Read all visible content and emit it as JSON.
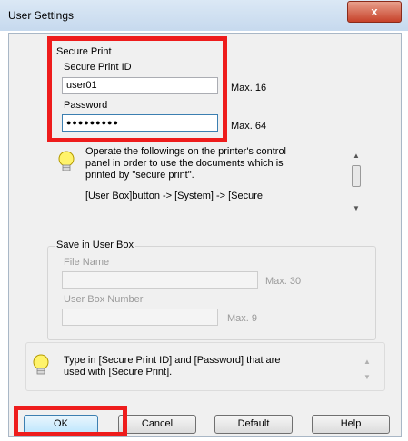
{
  "window": {
    "title": "User Settings",
    "close_glyph": "x"
  },
  "secure_print": {
    "group_label": "Secure Print",
    "id_label": "Secure Print ID",
    "id_value": "user01",
    "id_max": "Max. 16",
    "password_label": "Password",
    "password_value": "●●●●●●●●●",
    "password_max": "Max. 64",
    "info_lines": [
      "Operate the followings on the printer's control",
      "panel in order to use the documents which is",
      "printed by \"secure print\".",
      "[User Box]button -> [System] -> [Secure"
    ]
  },
  "save_in_user_box": {
    "group_label": "Save in User Box",
    "file_name_label": "File Name",
    "file_name_value": "",
    "file_name_max": "Max. 30",
    "box_number_label": "User Box Number",
    "box_number_value": "",
    "box_number_max": "Max. 9"
  },
  "hint": {
    "lines": [
      "Type in [Secure Print ID] and [Password] that are",
      "used with [Secure Print]."
    ]
  },
  "buttons": {
    "ok": "OK",
    "cancel": "Cancel",
    "default": "Default",
    "help": "Help"
  },
  "icons": {
    "bulb": "lightbulb-icon",
    "close": "close-icon"
  },
  "colors": {
    "highlight": "#ee1c1c",
    "title_bar": "#c6d9ee",
    "dialog_bg": "#f0f0f0"
  }
}
